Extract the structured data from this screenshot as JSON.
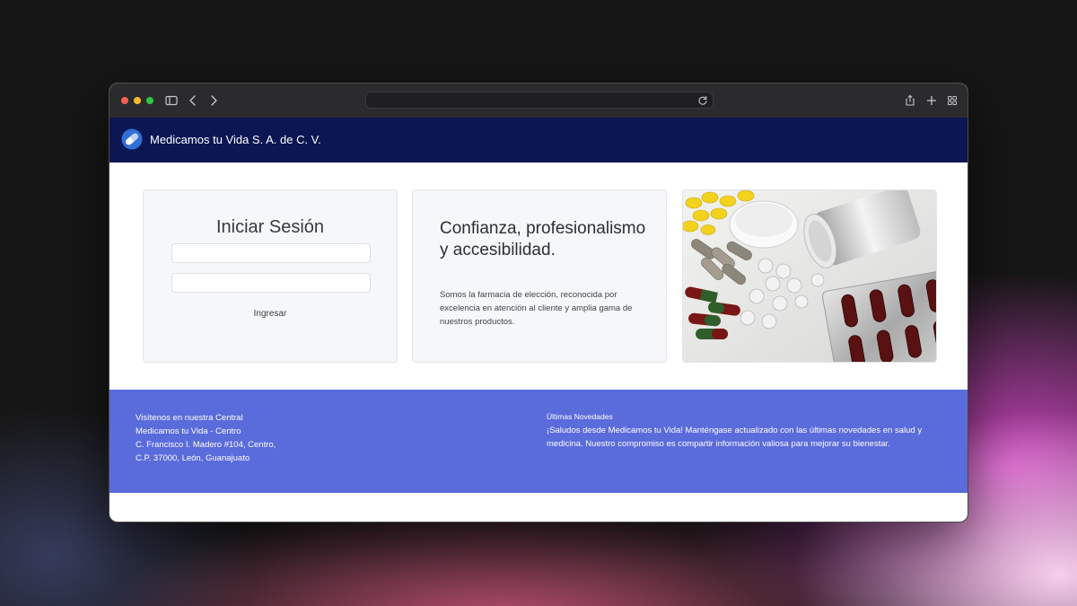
{
  "browser": {
    "url": "",
    "icons": {
      "sidebar": "sidebar-icon",
      "back": "chevron-left-icon",
      "forward": "chevron-right-icon",
      "reload": "reload-icon",
      "share": "share-icon",
      "new_tab": "plus-icon",
      "tabs": "tab-overview-icon"
    }
  },
  "navbar": {
    "brand": "Medicamos tu Vida S. A. de C. V.",
    "logo_icon": "pill-logo-icon",
    "background": "#0b1653"
  },
  "login": {
    "title": "Iniciar Sesión",
    "username_value": "",
    "password_value": "",
    "submit_label": "Ingresar"
  },
  "info": {
    "heading": "Confianza, profesionalismo y accesibilidad.",
    "body": "Somos la farmacia de elección, reconocida por excelencia en atención al cliente y amplia gama de nuestros productos."
  },
  "photo": {
    "subject": "pharmaceutical-pills-image"
  },
  "footer": {
    "background": "#5a6bdb",
    "address_lines": [
      "Visítenos en nuestra Central",
      "Medicamos tu Vida - Centro",
      "C. Francisco I. Madero #104, Centro,",
      "C.P. 37000, León, Guanajuato"
    ],
    "news_title": "Últimas Novedades",
    "news_text": "¡Saludos desde Medicamos tu Vida! Manténgase actualizado con las últimas novedades en salud y medicina. Nuestro compromiso es compartir información valiosa para mejorar su bienestar."
  }
}
